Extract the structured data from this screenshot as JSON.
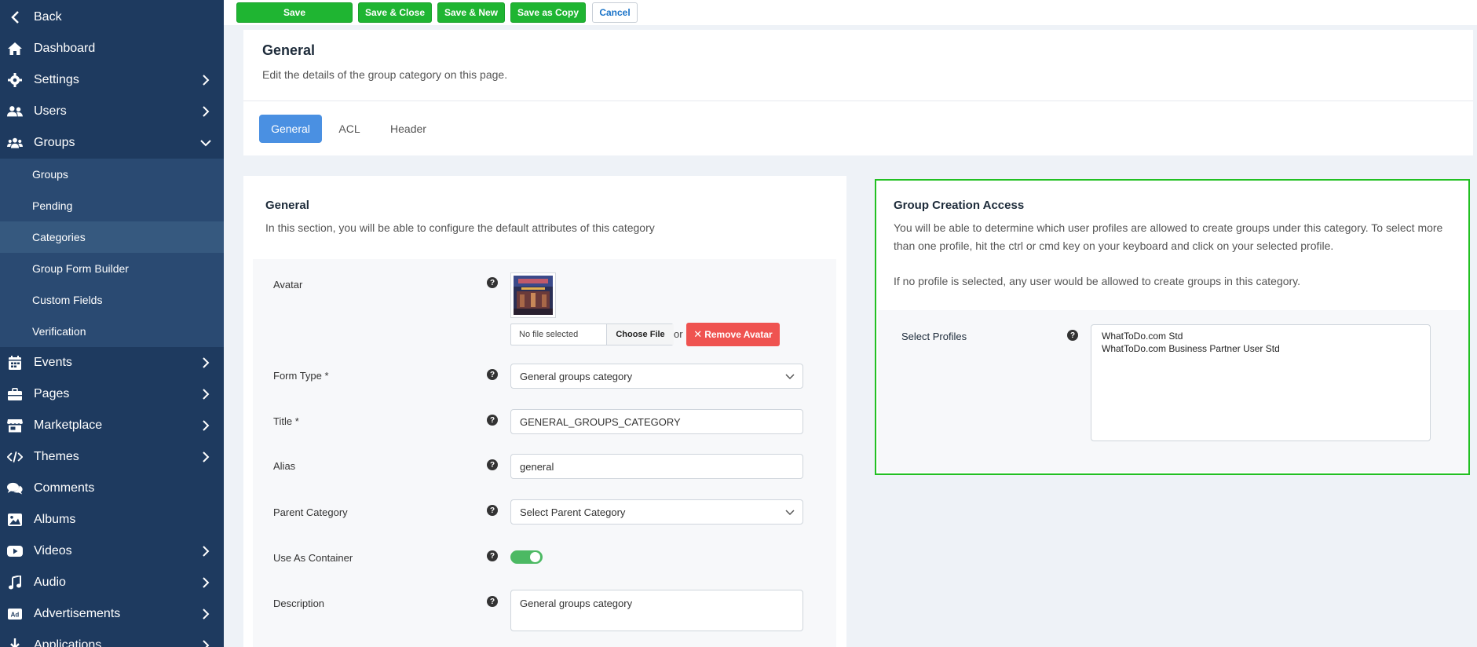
{
  "sidebar": {
    "back": "Back",
    "items": [
      {
        "label": "Dashboard",
        "icon": "home-icon"
      },
      {
        "label": "Settings",
        "icon": "gear-icon"
      },
      {
        "label": "Users",
        "icon": "users-icon"
      },
      {
        "label": "Groups",
        "icon": "groups-icon"
      },
      {
        "label": "Events",
        "icon": "calendar-icon"
      },
      {
        "label": "Pages",
        "icon": "briefcase-icon"
      },
      {
        "label": "Marketplace",
        "icon": "store-icon"
      },
      {
        "label": "Themes",
        "icon": "code-icon"
      },
      {
        "label": "Comments",
        "icon": "comments-icon"
      },
      {
        "label": "Albums",
        "icon": "image-icon"
      },
      {
        "label": "Videos",
        "icon": "video-icon"
      },
      {
        "label": "Audio",
        "icon": "music-icon"
      },
      {
        "label": "Advertisements",
        "icon": "ad-icon"
      },
      {
        "label": "Applications",
        "icon": "download-icon"
      }
    ],
    "groups_sub": [
      "Groups",
      "Pending",
      "Categories",
      "Group Form Builder",
      "Custom Fields",
      "Verification"
    ],
    "active_sub": "Categories"
  },
  "toolbar": {
    "save": "Save",
    "save_close": "Save & Close",
    "save_new": "Save & New",
    "save_copy": "Save as Copy",
    "cancel": "Cancel"
  },
  "header": {
    "title": "General",
    "subtitle": "Edit the details of the group category on this page.",
    "tabs": [
      "General",
      "ACL",
      "Header"
    ],
    "active_tab": "General"
  },
  "general": {
    "title": "General",
    "description": "In this section, you will be able to configure the default attributes of this category",
    "avatar_label": "Avatar",
    "file_status": "No file selected",
    "choose_file": "Choose File",
    "or": "or",
    "remove_avatar": "Remove Avatar",
    "form_type_label": "Form Type *",
    "form_type_value": "General groups category",
    "title_label": "Title *",
    "title_value": "GENERAL_GROUPS_CATEGORY",
    "alias_label": "Alias",
    "alias_value": "general",
    "parent_label": "Parent Category",
    "parent_value": "Select Parent Category",
    "container_label": "Use As Container",
    "container_on": true,
    "description_label": "Description",
    "description_value": "General groups category"
  },
  "access": {
    "title": "Group Creation Access",
    "desc1": "You will be able to determine which user profiles are allowed to create groups under this category. To select more than one profile, hit the ctrl or cmd key on your keyboard and click on your selected profile.",
    "desc2": "If no profile is selected, any user would be allowed to create groups in this category.",
    "select_label": "Select Profiles",
    "profiles": [
      "WhatToDo.com Std",
      "WhatToDo.com Business Partner User Std"
    ]
  },
  "colors": {
    "sidebar": "#1e3a5f",
    "submenu": "#2a4a72",
    "save_green": "#1fb532",
    "tab_blue": "#4a90e2",
    "remove_red": "#ef5350",
    "highlight_border": "#22c022",
    "toggle_green": "#4cb963"
  }
}
